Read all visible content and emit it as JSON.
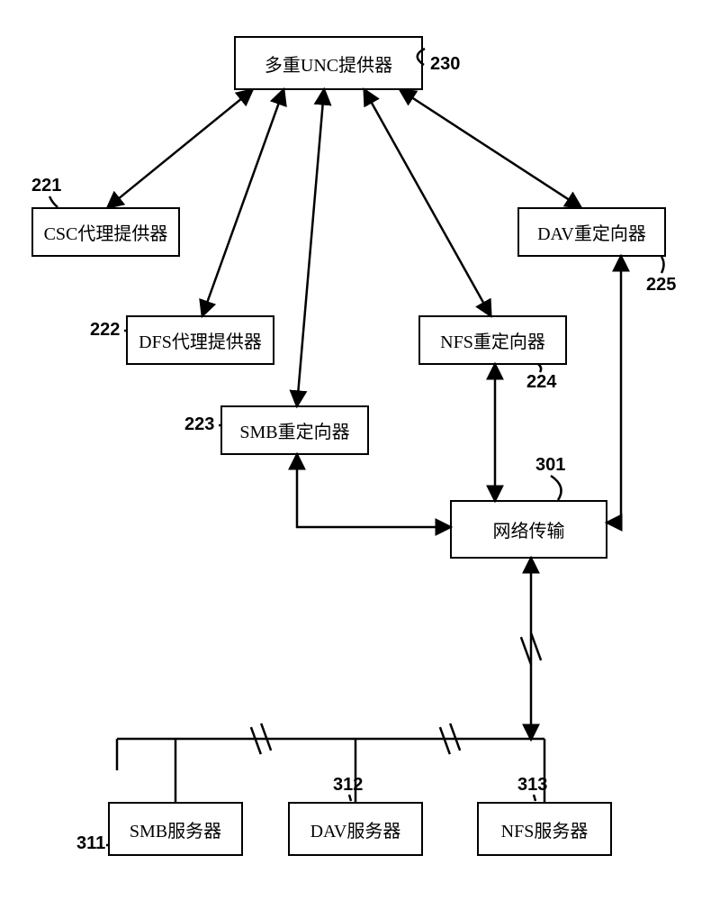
{
  "top_block": {
    "label": "多重UNC提供器",
    "ref": "230"
  },
  "row2": {
    "csc": {
      "label": "CSC代理提供器",
      "ref": "221"
    },
    "dav_redir": {
      "label": "DAV重定向器",
      "ref": "225"
    }
  },
  "row3": {
    "dfs": {
      "label": "DFS代理提供器",
      "ref": "222"
    },
    "nfs_redir": {
      "label": "NFS重定向器",
      "ref": "224"
    }
  },
  "smb_redir": {
    "label": "SMB重定向器",
    "ref": "223"
  },
  "net": {
    "label": "网络传输",
    "ref": "301"
  },
  "servers": {
    "smb": {
      "label": "SMB服务器",
      "ref": "311"
    },
    "dav": {
      "label": "DAV服务器",
      "ref": "312"
    },
    "nfs": {
      "label": "NFS服务器",
      "ref": "313"
    }
  },
  "chart_data": {
    "type": "diagram",
    "nodes": [
      {
        "id": "mup",
        "label": "多重UNC提供器",
        "ref": "230"
      },
      {
        "id": "csc",
        "label": "CSC代理提供器",
        "ref": "221"
      },
      {
        "id": "dfs",
        "label": "DFS代理提供器",
        "ref": "222"
      },
      {
        "id": "smb_redir",
        "label": "SMB重定向器",
        "ref": "223"
      },
      {
        "id": "nfs_redir",
        "label": "NFS重定向器",
        "ref": "224"
      },
      {
        "id": "dav_redir",
        "label": "DAV重定向器",
        "ref": "225"
      },
      {
        "id": "net",
        "label": "网络传输",
        "ref": "301"
      },
      {
        "id": "smb_srv",
        "label": "SMB服务器",
        "ref": "311"
      },
      {
        "id": "dav_srv",
        "label": "DAV服务器",
        "ref": "312"
      },
      {
        "id": "nfs_srv",
        "label": "NFS服务器",
        "ref": "313"
      }
    ],
    "edges": [
      {
        "from": "mup",
        "to": "csc",
        "bidir": true
      },
      {
        "from": "mup",
        "to": "dfs",
        "bidir": true
      },
      {
        "from": "mup",
        "to": "smb_redir",
        "bidir": true
      },
      {
        "from": "mup",
        "to": "nfs_redir",
        "bidir": true
      },
      {
        "from": "mup",
        "to": "dav_redir",
        "bidir": true
      },
      {
        "from": "smb_redir",
        "to": "net",
        "bidir": true
      },
      {
        "from": "nfs_redir",
        "to": "net",
        "bidir": true
      },
      {
        "from": "dav_redir",
        "to": "net",
        "bidir": true
      },
      {
        "from": "net",
        "to": "smb_srv",
        "bidir": true,
        "note": "via server bus"
      },
      {
        "from": "net",
        "to": "dav_srv",
        "bidir": true,
        "note": "via server bus"
      },
      {
        "from": "net",
        "to": "nfs_srv",
        "bidir": true,
        "note": "via server bus"
      }
    ]
  }
}
